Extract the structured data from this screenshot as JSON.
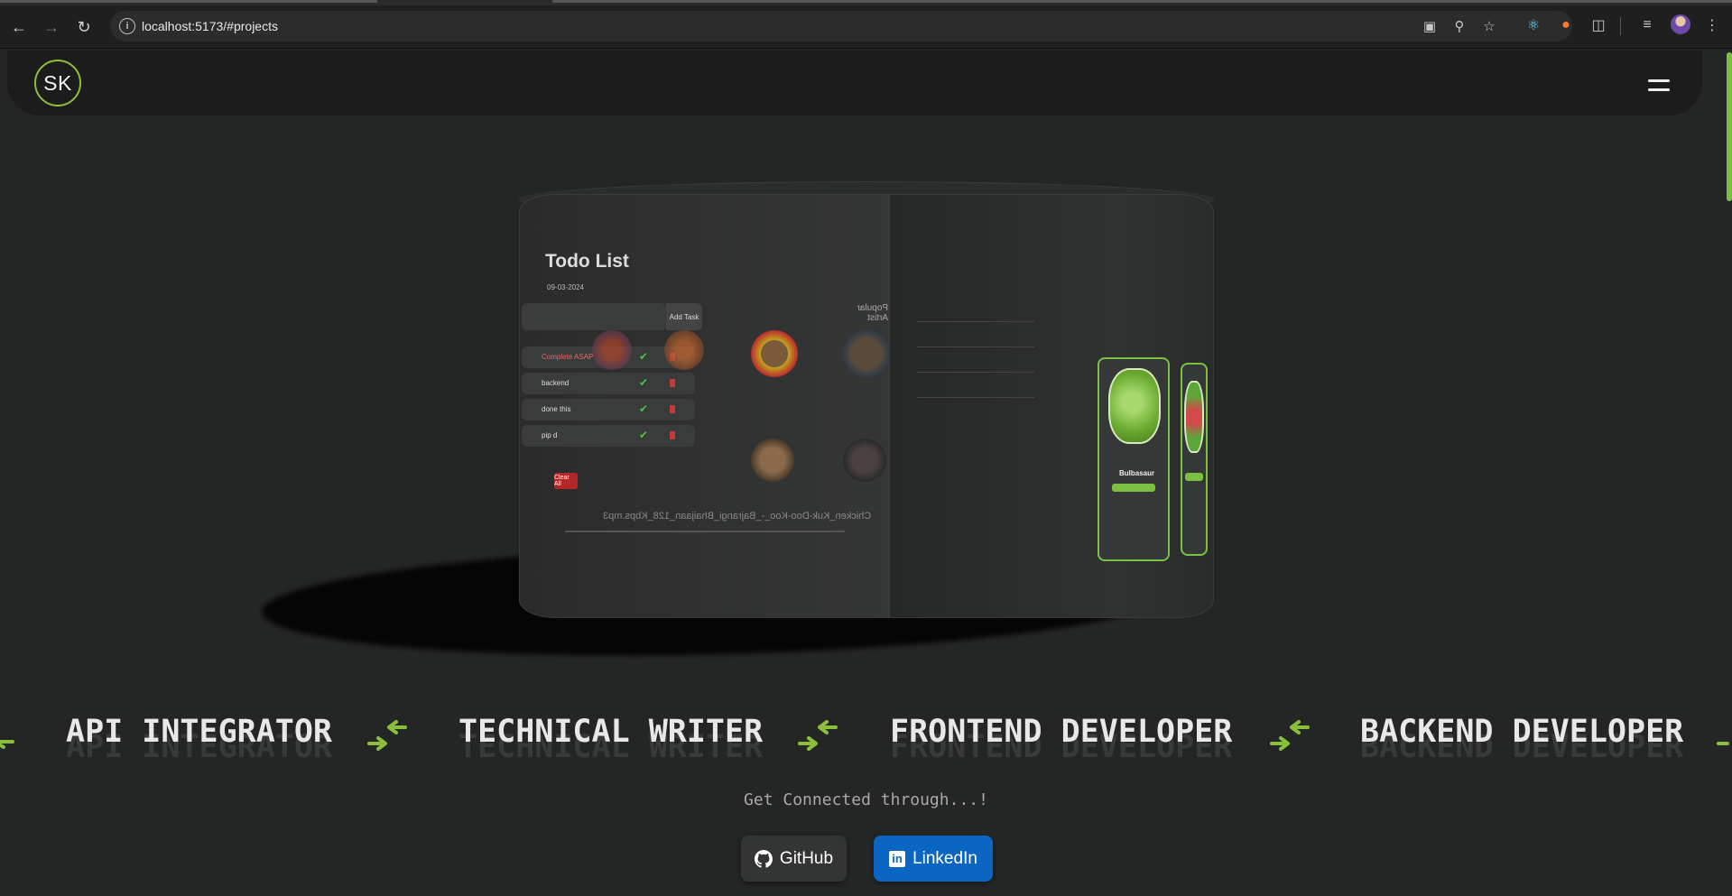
{
  "browser": {
    "url": "localhost:5173/#projects",
    "icons": [
      "back-icon",
      "forward-icon",
      "reload-icon",
      "site-info-icon",
      "translate-icon",
      "zoom-icon",
      "bookmark-star-icon",
      "react-devtools-icon",
      "extension-fox-icon",
      "extensions-puzzle-icon",
      "tab-search-icon",
      "profile-avatar",
      "more-menu-icon"
    ]
  },
  "header": {
    "logo_text": "SK",
    "menu_icon": "hamburger-icon"
  },
  "carousel": {
    "todo": {
      "title": "Todo List",
      "subtitle": "09-03-2024",
      "add_label": "Add Task",
      "items": [
        "Complete ASAP",
        "backend",
        "done this",
        "pip d"
      ],
      "clear_label": "Clear All"
    },
    "music": {
      "section_title": "Popular Artist",
      "now_playing": "Chicken_Kuk-Doo-Koo_-_Bajrangi_Bhaijaan_128_Kbps.mp3"
    },
    "pokemon": {
      "card_name": "Bulbasaur"
    }
  },
  "roles": [
    "API INTEGRATOR",
    "TECHNICAL WRITER",
    "FRONTEND DEVELOPER",
    "BACKEND DEVELOPER"
  ],
  "connect": {
    "text": "Get Connected through...!",
    "github_label": "GitHub",
    "linkedin_label": "LinkedIn"
  },
  "colors": {
    "accent": "#7bc043",
    "background": "#242625",
    "header_bg": "#1b1c1b",
    "linkedin": "#0a66c2"
  }
}
